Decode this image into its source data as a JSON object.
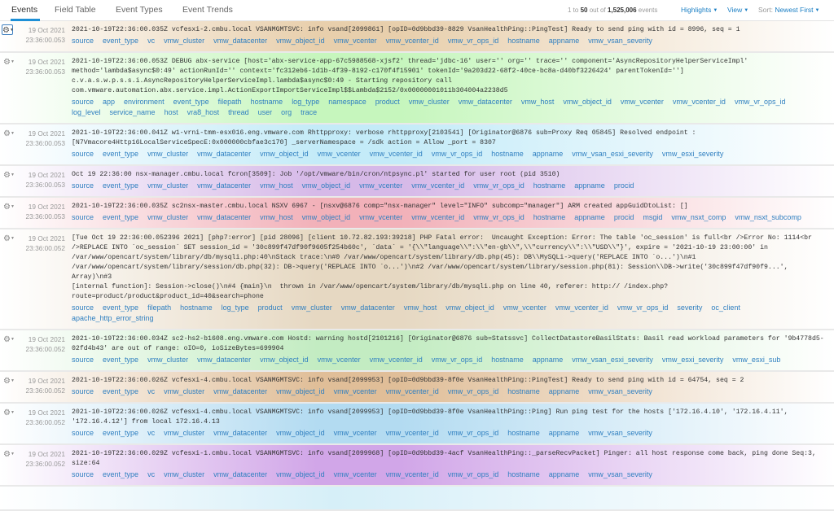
{
  "tabs": [
    "Events",
    "Field Table",
    "Event Types",
    "Event Trends"
  ],
  "summary": {
    "pre": "1 to ",
    "range": "50",
    "mid": " out of ",
    "total": "1,525,006",
    "post": " events"
  },
  "menus": {
    "highlights": "Highlights",
    "view": "View",
    "sort_label": "Sort: ",
    "sort_value": "Newest First"
  },
  "icons": {
    "row_menu": "gear-icon",
    "dropdown": "caret-down-icon"
  },
  "colors": {
    "field_link": "#2f7fc0",
    "active_tab": "#1d8fd6"
  },
  "events": [
    {
      "date": "19 Oct 2021",
      "time": "23:36:00.053",
      "color": "#e8cfac",
      "selected": true,
      "lines": [
        "2021-10-19T22:36:00.035Z vcfesxi-2.cmbu.local VSANMGMTSVC: info vsand[2099861] [opID=0d9bbd39-8829 VsanHealthPing::PingTest] Ready to send ping with id = 8996, seq = 1"
      ],
      "fields": [
        "source",
        "event_type",
        "vc",
        "vmw_cluster",
        "vmw_datacenter",
        "vmw_object_id",
        "vmw_vcenter",
        "vmw_vcenter_id",
        "vmw_vr_ops_id",
        "hostname",
        "appname",
        "vmw_vsan_severity"
      ]
    },
    {
      "date": "19 Oct 2021",
      "time": "23:36:00.053",
      "color": "#c6f6bd",
      "lines": [
        "2021-10-19T22:36:00.053Z DEBUG abx-service [host='abx-service-app-67c5988568-xjsf2' thread='jdbc-16' user='' org='' trace='' component='AsyncRepositoryHelperServiceImpl'",
        "method='lambda$async$0:49' actionRunId='' context='fc312eb6-1d1b-4f39-8192-c170f4f15901' tokenId='9a203d22-68f2-40ce-bc8a-d40bf3226424' parentTokenId='']",
        "c.v.a.s.w.p.s.s.i.AsyncRepositoryHelperServiceImpl.lambda$async$0:49 - Starting repository call",
        "com.vmware.automation.abx.service.impl.ActionExportImportServiceImpl$$Lambda$2152/0x00000001011b304004a2238d5"
      ],
      "fields": [
        "source",
        "app",
        "environment",
        "event_type",
        "filepath",
        "hostname",
        "log_type",
        "namespace",
        "product",
        "vmw_cluster",
        "vmw_datacenter",
        "vmw_host",
        "vmw_object_id",
        "vmw_vcenter",
        "vmw_vcenter_id",
        "vmw_vr_ops_id",
        "log_level",
        "service_name",
        "host",
        "vra8_host",
        "thread",
        "user",
        "org",
        "trace"
      ]
    },
    {
      "date": "19 Oct 2021",
      "time": "23:36:00.053",
      "color": "#c4ebf8",
      "lines": [
        "2021-10-19T22:36:00.041Z w1-vrni-tmm-esx016.eng.vmware.com Rhttpproxy: verbose rhttpproxy[2103541] [Originator@6876 sub=Proxy Req 05845] Resolved endpoint :",
        "[N7Vmacore4Http16LocalServiceSpecE:0x000000cbfae3c170] _serverNamespace = /sdk action = Allow _port = 8307"
      ],
      "fields": [
        "source",
        "event_type",
        "vmw_cluster",
        "vmw_datacenter",
        "vmw_object_id",
        "vmw_vcenter",
        "vmw_vcenter_id",
        "vmw_vr_ops_id",
        "hostname",
        "appname",
        "vmw_vsan_esxi_severity",
        "vmw_esxi_severity"
      ]
    },
    {
      "date": "19 Oct 2021",
      "time": "23:36:00.053",
      "color": "#d6b9e8",
      "lines": [
        "Oct 19 22:36:00 nsx-manager.cmbu.local fcron[3509]: Job '/opt/vmware/bin/cron/ntpsync.pl' started for user root (pid 3510)"
      ],
      "fields": [
        "source",
        "event_type",
        "vmw_cluster",
        "vmw_datacenter",
        "vmw_host",
        "vmw_object_id",
        "vmw_vcenter",
        "vmw_vcenter_id",
        "vmw_vr_ops_id",
        "hostname",
        "appname",
        "procid"
      ]
    },
    {
      "date": "19 Oct 2021",
      "time": "23:36:00.053",
      "color": "#f2b1b9",
      "lines": [
        "2021-10-19T22:36:00.035Z sc2nsx-master.cmbu.local NSXV 6967 - [nsxv@6876 comp=\"nsx-manager\" level=\"INFO\" subcomp=\"manager\"] ARM created appGuidDtoList: []"
      ],
      "fields": [
        "source",
        "event_type",
        "vmw_cluster",
        "vmw_datacenter",
        "vmw_host",
        "vmw_object_id",
        "vmw_vcenter",
        "vmw_vcenter_id",
        "vmw_vr_ops_id",
        "hostname",
        "appname",
        "procid",
        "msgid",
        "vmw_nsxt_comp",
        "vmw_nsxt_subcomp"
      ]
    },
    {
      "date": "19 Oct 2021",
      "time": "23:36:00.052",
      "color": "#e6d8c2",
      "lines": [
        "[Tue Oct 19 22:36:00.052396 2021] [php7:error] [pid 28096] [client 10.72.82.193:39218] PHP Fatal error:  Uncaught Exception: Error: The table 'oc_session' is full<br />Error No: 1114<br",
        "/>REPLACE INTO `oc_session` SET session_id = '30c899f47df90f9605f254b60c', `data` = '{\\\\\"language\\\\\":\\\\\"en-gb\\\\\",\\\\\"currency\\\\\":\\\\\"USD\\\\\"}', expire = '2021-10-19 23:00:00' in",
        "/var/www/opencart/system/library/db/mysqli.php:40\\nStack trace:\\n#0 /var/www/opencart/system/library/db.php(45): DB\\\\MySQLi->query('REPLACE INTO `o...')\\n#1",
        "/var/www/opencart/system/library/session/db.php(32): DB->query('REPLACE INTO `o...')\\n#2 /var/www/opencart/system/library/session.php(81): Session\\\\DB->write('30c899f47df90f9...', Array)\\n#3",
        "[internal function]: Session->close()\\n#4 {main}\\n  thrown in /var/www/opencart/system/library/db/mysqli.php on line 40, referer: http:// /index.php?",
        "route=product/product&product_id=40&search=phone"
      ],
      "fields": [
        "source",
        "event_type",
        "filepath",
        "hostname",
        "log_type",
        "product",
        "vmw_cluster",
        "vmw_datacenter",
        "vmw_host",
        "vmw_object_id",
        "vmw_vcenter",
        "vmw_vcenter_id",
        "vmw_vr_ops_id",
        "severity",
        "oc_client",
        "apache_http_error_string"
      ]
    },
    {
      "date": "19 Oct 2021",
      "time": "23:36:00.052",
      "color": "#c3ecc2",
      "lines": [
        "2021-10-19T22:36:00.034Z sc2-hs2-b1608.eng.vmware.com Hostd: warning hostd[2101216] [Originator@6876 sub=Statssvc] CollectDatastoreBasilStats: Basil read workload parameters for '9b4778d5-",
        "02fd4b43' are out of range: oIO=0, ioSizeBytes=699904"
      ],
      "fields": [
        "source",
        "event_type",
        "vmw_cluster",
        "vmw_datacenter",
        "vmw_object_id",
        "vmw_vcenter",
        "vmw_vcenter_id",
        "vmw_vr_ops_id",
        "hostname",
        "appname",
        "vmw_vsan_esxi_severity",
        "vmw_esxi_severity",
        "vmw_esxi_sub"
      ]
    },
    {
      "date": "19 Oct 2021",
      "time": "23:36:00.052",
      "color": "#e0be98",
      "lines": [
        "2021-10-19T22:36:00.026Z vcfesxi-4.cmbu.local VSANMGMTSVC: info vsand[2099953] [opID=0d9bbd39-8f0e VsanHealthPing::PingTest] Ready to send ping with id = 64754, seq = 2"
      ],
      "fields": [
        "source",
        "event_type",
        "vc",
        "vmw_cluster",
        "vmw_datacenter",
        "vmw_object_id",
        "vmw_vcenter",
        "vmw_vcenter_id",
        "vmw_vr_ops_id",
        "hostname",
        "appname",
        "vmw_vsan_severity"
      ]
    },
    {
      "date": "19 Oct 2021",
      "time": "23:36:00.052",
      "color": "#b3dbf1",
      "lines": [
        "2021-10-19T22:36:00.026Z vcfesxi-4.cmbu.local VSANMGMTSVC: info vsand[2099953] [opID=0d9bbd39-8f0e VsanHealthPing::Ping] Run ping test for the hosts ['172.16.4.10', '172.16.4.11',",
        "'172.16.4.12'] from local 172.16.4.13"
      ],
      "fields": [
        "source",
        "event_type",
        "vc",
        "vmw_cluster",
        "vmw_datacenter",
        "vmw_object_id",
        "vmw_vcenter",
        "vmw_vcenter_id",
        "vmw_vr_ops_id",
        "hostname",
        "appname",
        "vmw_vsan_severity"
      ]
    },
    {
      "date": "19 Oct 2021",
      "time": "23:36:00.052",
      "color": "#d1a6e8",
      "lines": [
        "2021-10-19T22:36:00.029Z vcfesxi-1.cmbu.local VSANMGMTSVC: info vsand[2099968] [opID=0d9bbd39-4acf VsanHealthPing::_parseRecvPacket] Pinger: all host response come back, ping done Seq:3,",
        "size:64"
      ],
      "fields": [
        "source",
        "event_type",
        "vc",
        "vmw_cluster",
        "vmw_datacenter",
        "vmw_object_id",
        "vmw_vcenter",
        "vmw_vcenter_id",
        "vmw_vr_ops_id",
        "hostname",
        "appname",
        "vmw_vsan_severity"
      ]
    }
  ]
}
